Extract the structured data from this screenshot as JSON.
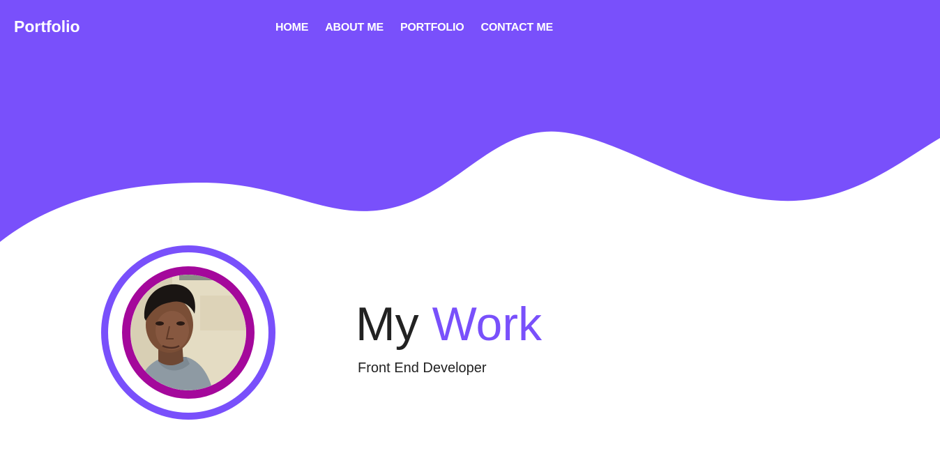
{
  "brand": {
    "name": "Portfolio"
  },
  "nav": {
    "items": [
      {
        "label": "HOME"
      },
      {
        "label": "ABOUT ME"
      },
      {
        "label": "PORTFOLIO"
      },
      {
        "label": "CONTACT ME"
      }
    ]
  },
  "hero": {
    "title_part1": "My",
    "title_part2": "Work",
    "subtitle": "Front End Developer"
  },
  "avatar": {
    "icon": "profile-photo"
  },
  "colors": {
    "primary": "#7950fb",
    "ring_inner": "#a4089b",
    "text_dark": "#222222",
    "white": "#ffffff"
  }
}
